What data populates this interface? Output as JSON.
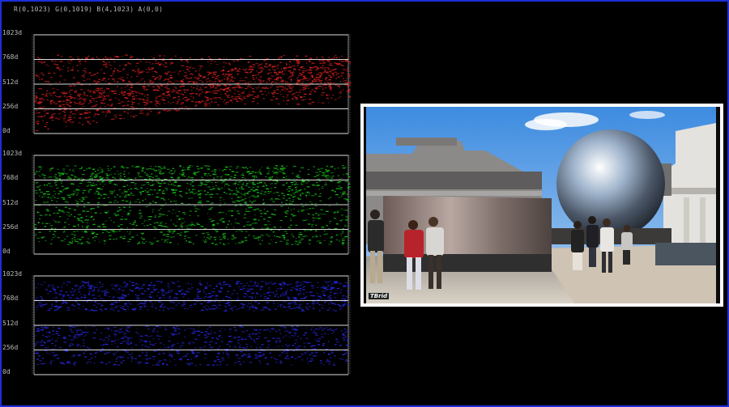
{
  "readout": "R(0,1023) G(0,1019) B(4,1023) A(0,0)",
  "panels": [
    {
      "name": "red",
      "color": "#d42020",
      "ticks": [
        "1023d",
        "768d",
        "512d",
        "256d",
        "0d"
      ]
    },
    {
      "name": "green",
      "color": "#18c418",
      "ticks": [
        "1023d",
        "768d",
        "512d",
        "256d",
        "0d"
      ]
    },
    {
      "name": "blue",
      "color": "#2828e0",
      "ticks": [
        "1023d",
        "768d",
        "512d",
        "256d",
        "0d"
      ]
    }
  ],
  "preview": {
    "watermark": "TBrid"
  },
  "colors": {
    "border": "#1c2fd8",
    "background": "#000000",
    "graticule": "#dddddd"
  }
}
